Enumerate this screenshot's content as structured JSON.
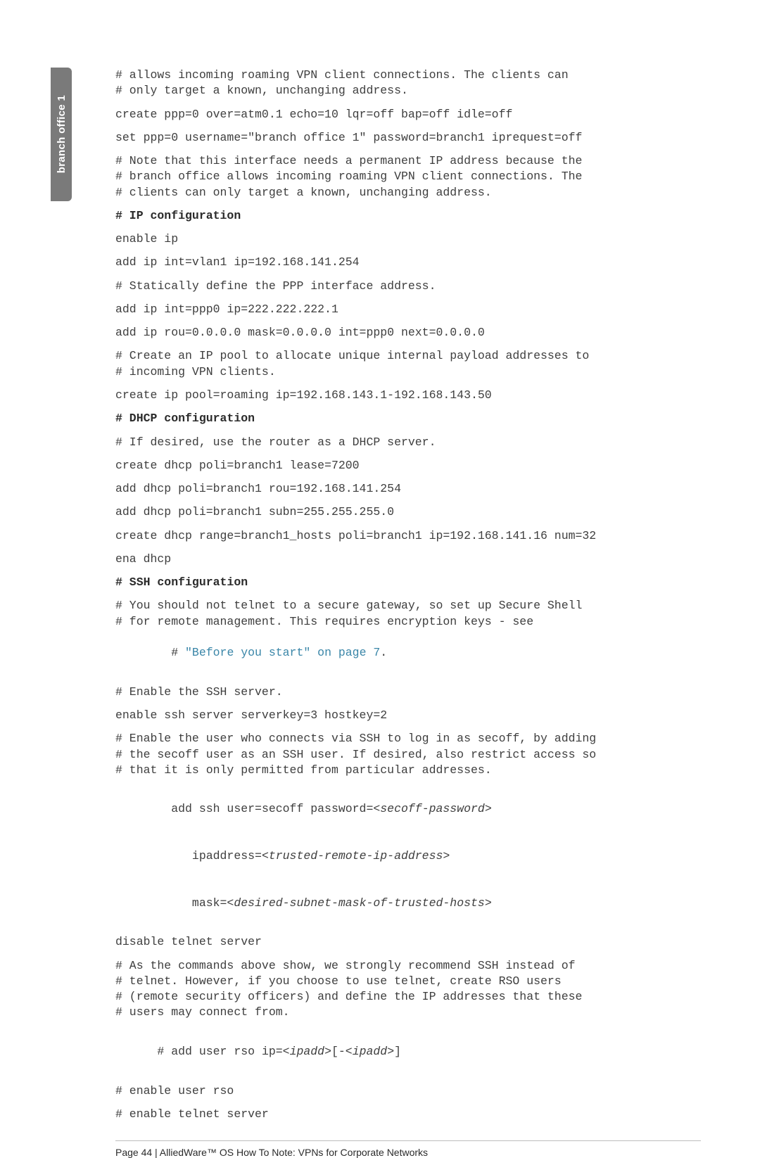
{
  "sideTab": "branch office 1",
  "lines": {
    "c01": "# allows incoming roaming VPN client connections. The clients can\n# only target a known, unchanging address.",
    "l01": "create ppp=0 over=atm0.1 echo=10 lqr=off bap=off idle=off",
    "l02": "set ppp=0 username=\"branch office 1\" password=branch1 iprequest=off",
    "c02": "# Note that this interface needs a permanent IP address because the\n# branch office allows incoming roaming VPN client connections. The\n# clients can only target a known, unchanging address.",
    "h01": "# IP configuration",
    "l03": "enable ip",
    "l04": "add ip int=vlan1 ip=192.168.141.254",
    "c03": "# Statically define the PPP interface address.",
    "l05": "add ip int=ppp0 ip=222.222.222.1",
    "l06": "add ip rou=0.0.0.0 mask=0.0.0.0 int=ppp0 next=0.0.0.0",
    "c04": "# Create an IP pool to allocate unique internal payload addresses to\n# incoming VPN clients.",
    "l07": "create ip pool=roaming ip=192.168.143.1-192.168.143.50",
    "h02": "# DHCP configuration",
    "c05": "# If desired, use the router as a DHCP server.",
    "l08": "create dhcp poli=branch1 lease=7200",
    "l09": "add dhcp poli=branch1 rou=192.168.141.254",
    "l10": "add dhcp poli=branch1 subn=255.255.255.0",
    "l11": "create dhcp range=branch1_hosts poli=branch1 ip=192.168.141.16 num=32",
    "l12": "ena dhcp",
    "h03": "# SSH configuration",
    "c06a": "# You should not telnet to a secure gateway, so set up Secure Shell\n# for remote management. This requires encryption keys - see",
    "c06b_prefix": "# ",
    "c06b_link": "\"Before you start\" on page 7",
    "c06b_suffix": ".",
    "c07": "# Enable the SSH server.",
    "l13": "enable ssh server serverkey=3 hostkey=2",
    "c08": "# Enable the user who connects via SSH to log in as secoff, by adding\n# the secoff user as an SSH user. If desired, also restrict access so\n# that it is only permitted from particular addresses.",
    "l14_a": "add ssh user=secoff password=<",
    "l14_i1": "secoff-password",
    "l14_b": ">",
    "l14_c": "ipaddress=<",
    "l14_i2": "trusted-remote-ip-address",
    "l14_d": ">",
    "l14_e": "mask=<",
    "l14_i3": "desired-subnet-mask-of-trusted-hosts",
    "l14_f": ">",
    "l15": "disable telnet server",
    "c09": "# As the commands above show, we strongly recommend SSH instead of\n# telnet. However, if you choose to use telnet, create RSO users\n# (remote security officers) and define the IP addresses that these\n# users may connect from.",
    "c10_a": "# add user rso ip=<",
    "c10_i1": "ipadd",
    "c10_b": ">[-<",
    "c10_i2": "ipadd",
    "c10_c": ">]",
    "c11": "# enable user rso",
    "c12": "# enable telnet server"
  },
  "footer": "Page 44 | AlliedWare™ OS How To Note: VPNs for Corporate Networks"
}
